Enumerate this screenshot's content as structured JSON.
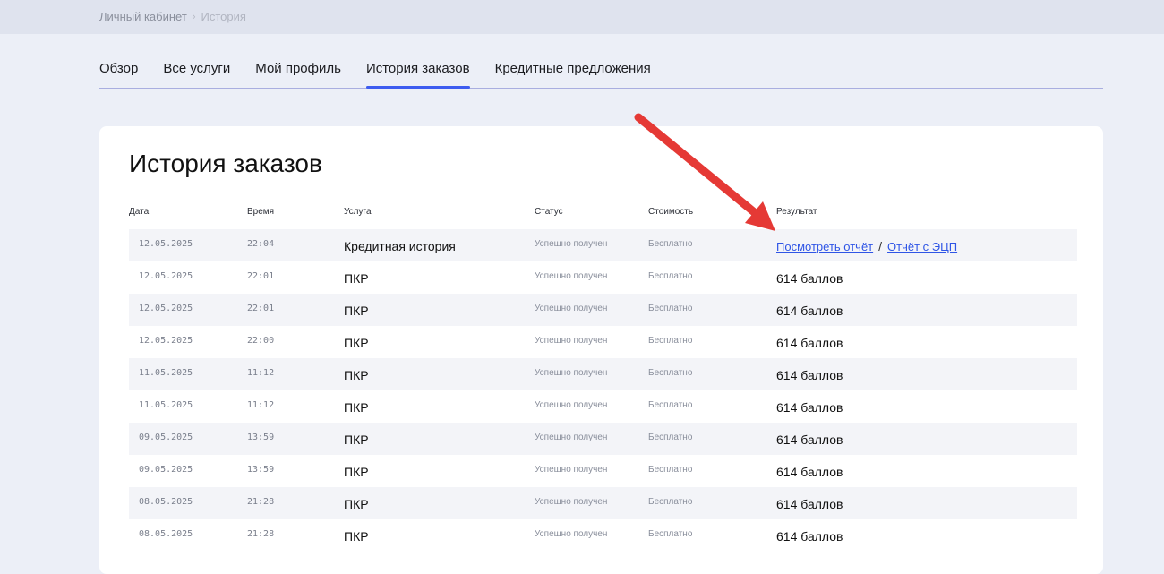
{
  "breadcrumb": {
    "root": "Личный кабинет",
    "separator": "›",
    "current": "История"
  },
  "tabs": [
    {
      "label": "Обзор",
      "active": false
    },
    {
      "label": "Все услуги",
      "active": false
    },
    {
      "label": "Мой профиль",
      "active": false
    },
    {
      "label": "История заказов",
      "active": true
    },
    {
      "label": "Кредитные предложения",
      "active": false
    }
  ],
  "card": {
    "title": "История заказов"
  },
  "table": {
    "columns": [
      "Дата",
      "Время",
      "Услуга",
      "Статус",
      "Стоимость",
      "Результат"
    ],
    "rows": [
      {
        "date": "12.05.2025",
        "time": "22:04",
        "service": "Кредитная история",
        "status": "Успешно получен",
        "cost": "Бесплатно",
        "result": {
          "type": "links",
          "link1": "Посмотреть отчёт",
          "separator": "/",
          "link2": "Отчёт с ЭЦП"
        }
      },
      {
        "date": "12.05.2025",
        "time": "22:01",
        "service": "ПКР",
        "status": "Успешно получен",
        "cost": "Бесплатно",
        "result": {
          "type": "text",
          "text": "614 баллов"
        }
      },
      {
        "date": "12.05.2025",
        "time": "22:01",
        "service": "ПКР",
        "status": "Успешно получен",
        "cost": "Бесплатно",
        "result": {
          "type": "text",
          "text": "614 баллов"
        }
      },
      {
        "date": "12.05.2025",
        "time": "22:00",
        "service": "ПКР",
        "status": "Успешно получен",
        "cost": "Бесплатно",
        "result": {
          "type": "text",
          "text": "614 баллов"
        }
      },
      {
        "date": "11.05.2025",
        "time": "11:12",
        "service": "ПКР",
        "status": "Успешно получен",
        "cost": "Бесплатно",
        "result": {
          "type": "text",
          "text": "614 баллов"
        }
      },
      {
        "date": "11.05.2025",
        "time": "11:12",
        "service": "ПКР",
        "status": "Успешно получен",
        "cost": "Бесплатно",
        "result": {
          "type": "text",
          "text": "614 баллов"
        }
      },
      {
        "date": "09.05.2025",
        "time": "13:59",
        "service": "ПКР",
        "status": "Успешно получен",
        "cost": "Бесплатно",
        "result": {
          "type": "text",
          "text": "614 баллов"
        }
      },
      {
        "date": "09.05.2025",
        "time": "13:59",
        "service": "ПКР",
        "status": "Успешно получен",
        "cost": "Бесплатно",
        "result": {
          "type": "text",
          "text": "614 баллов"
        }
      },
      {
        "date": "08.05.2025",
        "time": "21:28",
        "service": "ПКР",
        "status": "Успешно получен",
        "cost": "Бесплатно",
        "result": {
          "type": "text",
          "text": "614 баллов"
        }
      },
      {
        "date": "08.05.2025",
        "time": "21:28",
        "service": "ПКР",
        "status": "Успешно получен",
        "cost": "Бесплатно",
        "result": {
          "type": "text",
          "text": "614 баллов"
        }
      }
    ]
  },
  "colors": {
    "page_bg": "#eceff7",
    "topbar_bg": "#dfe3ee",
    "accent": "#3d5cf0",
    "link": "#2f55e6",
    "stripe": "#f3f4f8",
    "annotation_arrow": "#e53935"
  },
  "icons": {
    "annotation": "red-arrow-icon"
  }
}
